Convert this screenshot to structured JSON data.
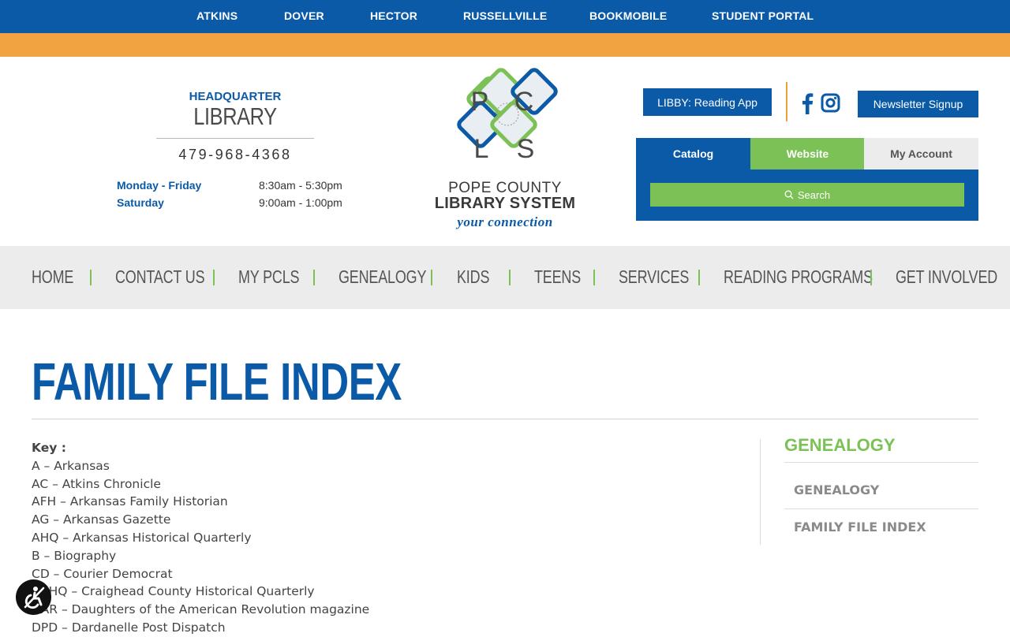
{
  "topnav": {
    "items": [
      "ATKINS",
      "DOVER",
      "HECTOR",
      "RUSSELLVILLE",
      "BOOKMOBILE",
      "STUDENT PORTAL"
    ]
  },
  "colors": {
    "primary_blue": "#0a5aa8",
    "orange": "#f2a341",
    "green": "#7cc155",
    "nav_bg": "#ececec"
  },
  "header": {
    "hq_title": "HEADQUARTER",
    "hq_subtitle": "LIBRARY",
    "phone": "479-968-4368",
    "hours": [
      {
        "label": "Monday - Friday",
        "value": "8:30am - 5:30pm"
      },
      {
        "label": "Saturday",
        "value": "9:00am - 1:00pm"
      }
    ]
  },
  "logo": {
    "letters": [
      "P",
      "C",
      "L",
      "S"
    ],
    "line1": "POPE COUNTY",
    "line2": "LIBRARY SYSTEM",
    "tagline": "your connection"
  },
  "actions": {
    "libby": "LIBBY: Reading App",
    "newsletter": "Newsletter Signup",
    "social_icons": [
      "facebook-icon",
      "instagram-icon"
    ]
  },
  "search": {
    "tabs": [
      "Catalog",
      "Website",
      "My Account"
    ],
    "active_tab": "Website",
    "button": "Search"
  },
  "mainnav": {
    "items": [
      "HOME",
      "CONTACT US",
      "MY PCLS",
      "GENEALOGY",
      "KIDS",
      "TEENS",
      "SERVICES",
      "READING PROGRAMS",
      "GET INVOLVED"
    ]
  },
  "page": {
    "title": "FAMILY FILE INDEX",
    "key_heading": "Key :",
    "key_items": [
      "A – Arkansas",
      "AC – Atkins Chronicle",
      "AFH – Arkansas Family Historian",
      "AG – Arkansas Gazette",
      "AHQ – Arkansas Historical Quarterly",
      "B – Biography",
      "CD – Courier Democrat",
      "CCHQ – Craighead County Historical Quarterly",
      "DAR – Daughters of the American Revolution magazine",
      "DPD – Dardanelle Post Dispatch"
    ]
  },
  "sidebar": {
    "title": "GENEALOGY",
    "links": [
      "GENEALOGY",
      "FAMILY FILE INDEX"
    ]
  }
}
